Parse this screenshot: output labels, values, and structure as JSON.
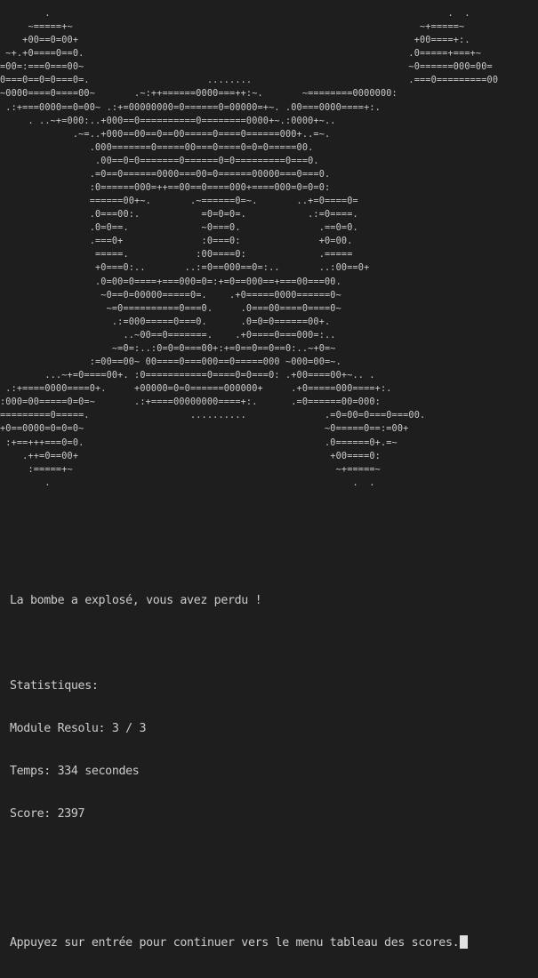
{
  "ascii_art": [
    "        .                                                                       .  .",
    "     ~=====+~                                                              ~+=====~",
    "    +00==0=00+                                                            +00====+:.",
    " ~+.+0====0==0.                                                          .0=====+===+~",
    "=00=:===0===00~                                                          ~0======000=00=",
    "0===0==0=0===0=.                     ........                            .===0=========00",
    "~0000====0====00~       .~:++======0000===++:~.       ~========0000000:",
    " .:+===0000==0=00~ .:+=00000000=0======0=00000=+~. .00===0000====+:.",
    "     . ..~+=000:..+000==0==========0========0000+~.:0000+~..",
    "             .~=..+000==00==0==00=====0====0======000+..=~.",
    "                .000=======0=====00===0====0=0=0=====00.",
    "                 .00==0=0=======0======0=0=========0===0.",
    "                .=0==0======0000===00=0======00000===0===0.",
    "                :0======000=++==00==0====000+====000=0=0=0:",
    "                ======00+~.       .~======0=~.       ..+=0====0=",
    "                .0===00:.           =0=0=0=.           .:=0====.",
    "                .0=0==.             ~0===0.              .==0=0.",
    "                .===0+              :0===0:              +0=00.",
    "                 =====.            :00====0:             .=====",
    "                 +0===0:..       ..:=0==000==0=:..       ..:00==0+",
    "                 .0=00=0====+===000=0=:+=0==000==+===00===00.",
    "                  ~0==0=00000=====0=.    .+0=====0000======0~",
    "                   ~=0==========0===0.     .0===00====0====0~",
    "                    .:=000=====0===0.      .0=0=0======00+.",
    "                      ..~00==0=======.    .+0====0===000=:..",
    "                    ~=0=:..:0=0=0===00+:+=0==0==0==0:..~+0=~",
    "                :=00==00~ 00====0===000==0=====000 ~000=00=~.",
    "        ...~+=0====00+. :0===========0====0=0===0: .+00====00+~.. .",
    " .:+====0000====0+.     +00000=0=0======000000+     .+0=====000====+:.",
    ":000=00=====0=0=~       .:+====00000000====+:.      .=0======00=000:",
    "=========0=====.                  ..........              .=0=00=0===0===00.",
    "+0==0000=0=0=0~                                           ~0=====0==:=00+",
    " :+==+++===0=0.                                           .0======0+.=~",
    "    .++=0==00+                                             +00====0:",
    "     :=====+~                                               ~+=====~",
    "        .                                                      .  ."
  ],
  "game_over_message": "La bombe a explosé, vous avez perdu !",
  "stats": {
    "header": "Statistiques:",
    "modules": "Module Resolu: 3 / 3",
    "time": "Temps: 334 secondes",
    "score": "Score: 2397"
  },
  "prompt": "Appuyez sur entrée pour continuer vers le menu tableau des scores."
}
